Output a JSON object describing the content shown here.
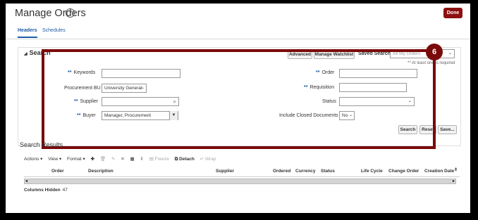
{
  "page": {
    "title": "Manage Orders",
    "done_label": "Done"
  },
  "tabs": [
    {
      "label": "Headers"
    },
    {
      "label": "Schedules"
    }
  ],
  "search": {
    "header": "Search",
    "advanced_label": "Advanced",
    "manage_watchlist_label": "Manage Watchlist",
    "saved_search_label": "Saved Search",
    "saved_search_value": "All My Orders",
    "required_note": "** At least one is required",
    "keywords_label": "Keywords",
    "order_label": "Order",
    "procurement_bu_label": "Procurement BU",
    "procurement_bu_value": "University General",
    "requisition_label": "Requisition",
    "supplier_label": "Supplier",
    "status_label": "Status",
    "buyer_label": "Buyer",
    "buyer_value": "Manager, Procurement",
    "include_closed_label": "Include Closed Documents",
    "include_closed_value": "No",
    "search_button": "Search",
    "reset_button": "Reset",
    "save_button": "Save..."
  },
  "callout": {
    "step": "6"
  },
  "results": {
    "title": "Search Results",
    "toolbar": {
      "actions": "Actions",
      "view": "View",
      "format": "Format",
      "freeze": "Freeze",
      "detach": "Detach",
      "wrap": "Wrap"
    },
    "columns": [
      "Order",
      "Description",
      "Supplier",
      "Ordered",
      "Currency",
      "Status",
      "Life Cycle",
      "Change Order",
      "Creation Date"
    ],
    "columns_hidden_label": "Columns Hidden",
    "columns_hidden_count": "47"
  }
}
